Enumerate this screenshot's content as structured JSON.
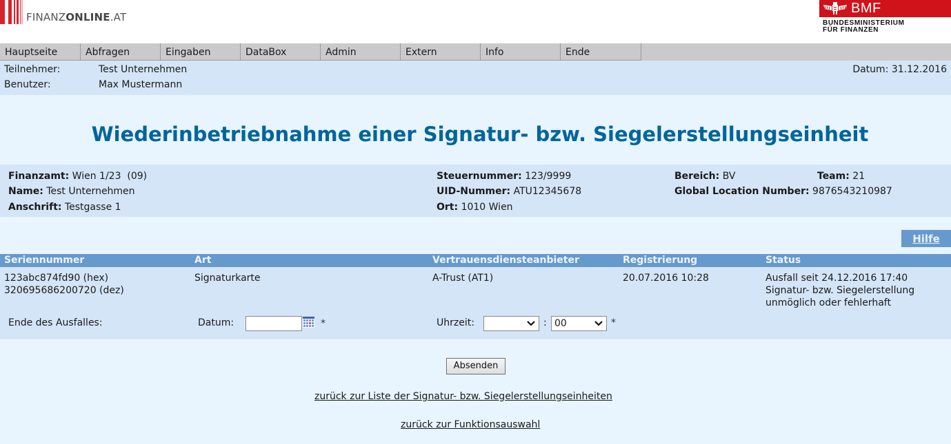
{
  "header": {
    "brand_light": "FINANZ",
    "brand_bold": "ONLINE",
    "brand_suffix": ".AT",
    "ministry_short": "BMF",
    "ministry_line1": "BUNDESMINISTERIUM",
    "ministry_line2": "FÜR FINANZEN",
    "brand_color": "#d9232a"
  },
  "nav": {
    "items": [
      {
        "label": "Hauptseite"
      },
      {
        "label": "Abfragen"
      },
      {
        "label": "Eingaben"
      },
      {
        "label": "DataBox"
      },
      {
        "label": "Admin"
      },
      {
        "label": "Extern"
      },
      {
        "label": "Info"
      },
      {
        "label": "Ende"
      }
    ]
  },
  "userinfo": {
    "participant_label": "Teilnehmer:",
    "participant_value": "Test Unternehmen",
    "user_label": "Benutzer:",
    "user_value": "Max Mustermann",
    "date_text": "Datum: 31.12.2016"
  },
  "page": {
    "title": "Wiederinbetriebnahme einer Signatur- bzw. Siegelerstellungseinheit",
    "title_color": "#00659b"
  },
  "taxpayer": {
    "finanzamt_label": "Finanzamt:",
    "finanzamt_value": "Wien 1/23  (09)",
    "name_label": "Name:",
    "name_value": "Test Unternehmen",
    "anschrift_label": "Anschrift:",
    "anschrift_value": "Testgasse 1",
    "steuernummer_label": "Steuernummer:",
    "steuernummer_value": "123/9999",
    "uid_label": "UID-Nummer:",
    "uid_value": "ATU12345678",
    "ort_label": "Ort:",
    "ort_value": "1010 Wien",
    "bereich_label": "Bereich:",
    "bereich_value": "BV",
    "team_label": "Team:",
    "team_value": "21",
    "gln_label": "Global Location Number:",
    "gln_value": "9876543210987"
  },
  "help": {
    "label": "Hilfe"
  },
  "table": {
    "headers": [
      "Seriennummer",
      "Art",
      "Vertrauensdiensteanbieter",
      "Registrierung",
      "Status"
    ],
    "row": {
      "serial_hex": "123abc874fd90 (hex)",
      "serial_dec": "320695686200720 (dez)",
      "art": "Signaturkarte",
      "provider": "A-Trust (AT1)",
      "registration": "20.07.2016 10:28",
      "status_line1": "Ausfall seit 24.12.2016 17:40",
      "status_line2": "Signatur- bzw. Siegelerstellung",
      "status_line3": "unmöglich oder fehlerhaft"
    }
  },
  "form": {
    "end_label": "Ende des Ausfalles:",
    "date_label": "Datum:",
    "date_value": "",
    "time_label": "Uhrzeit:",
    "hour_value": "",
    "separator": ":",
    "minute_value": "00",
    "required_marker": "*",
    "submit_label": "Absenden"
  },
  "links": {
    "back_to_list": "zurück zur Liste der Signatur- bzw. Siegelerstellungseinheiten",
    "back_to_functions": "zurück zur Funktionsauswahl"
  }
}
